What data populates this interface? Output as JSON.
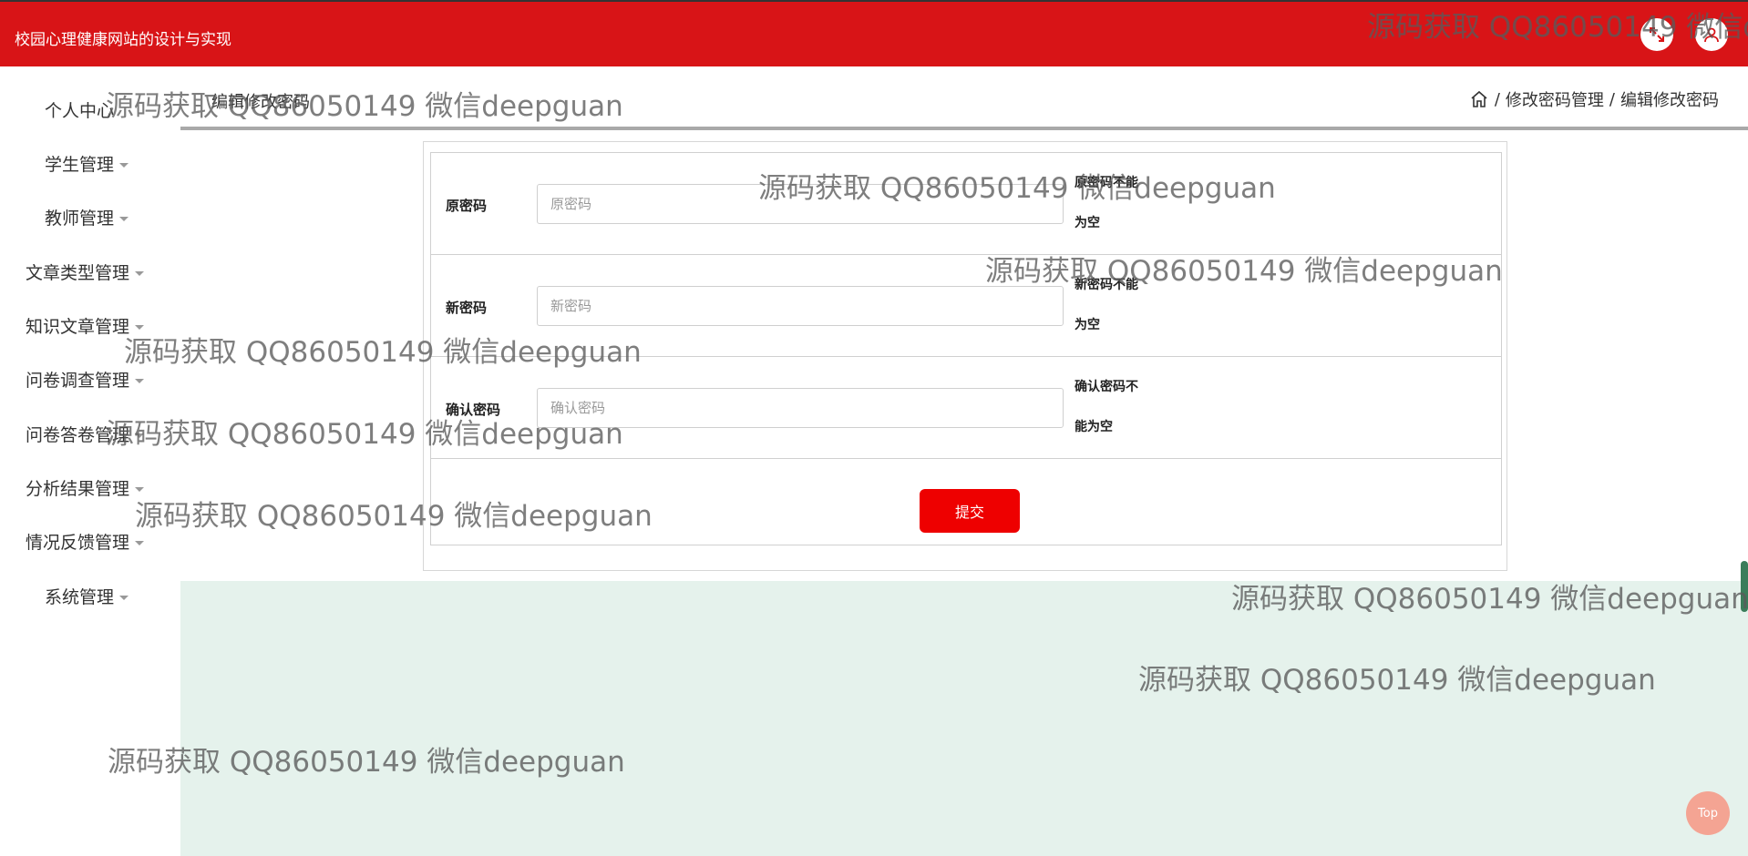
{
  "header": {
    "site_title": "校园心理健康网站的设计与实现",
    "icons": [
      "expand-icon",
      "user-icon"
    ]
  },
  "sidebar": {
    "items": [
      {
        "label": "个人中心",
        "has_caret": false
      },
      {
        "label": "学生管理",
        "has_caret": true
      },
      {
        "label": "教师管理",
        "has_caret": true
      },
      {
        "label": "文章类型管理",
        "has_caret": true
      },
      {
        "label": "知识文章管理",
        "has_caret": true
      },
      {
        "label": "问卷调查管理",
        "has_caret": true
      },
      {
        "label": "问卷答卷管理",
        "has_caret": true
      },
      {
        "label": "分析结果管理",
        "has_caret": true
      },
      {
        "label": "情况反馈管理",
        "has_caret": true
      },
      {
        "label": "系统管理",
        "has_caret": true
      }
    ]
  },
  "page": {
    "heading": "编辑修改密码",
    "breadcrumb": [
      "修改密码管理",
      "编辑修改密码"
    ],
    "breadcrumb_sep": "/"
  },
  "form": {
    "old_password": {
      "label": "原密码",
      "placeholder": "原密码",
      "error_line1": "原密码不能",
      "error_line2": "为空"
    },
    "new_password": {
      "label": "新密码",
      "placeholder": "新密码",
      "error_line1": "新密码不能",
      "error_line2": "为空"
    },
    "confirm_password": {
      "label": "确认密码",
      "placeholder": "确认密码",
      "error_line1": "确认密码不",
      "error_line2": "能为空"
    },
    "submit_label": "提交"
  },
  "back_to_top_label": "Top",
  "watermark_text": "源码获取 QQ86050149 微信deepguan",
  "colors": {
    "header_bg": "#d81417",
    "submit_bg": "#ee0000",
    "content_bg": "#e5f2ec",
    "top_button": "#f4a493"
  }
}
